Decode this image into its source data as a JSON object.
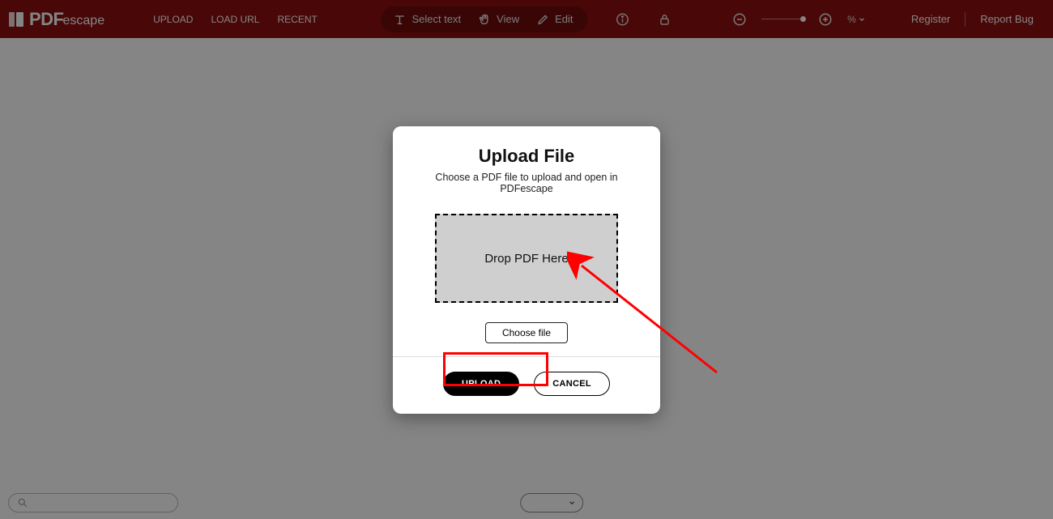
{
  "brand": {
    "prefix": "PDF",
    "suffix": "escape"
  },
  "nav": {
    "upload": "UPLOAD",
    "loadurl": "LOAD URL",
    "recent": "RECENT"
  },
  "toolbar": {
    "select_text": "Select text",
    "view": "View",
    "edit": "Edit",
    "zoom_value": "%"
  },
  "header_right": {
    "register": "Register",
    "report_bug": "Report Bug"
  },
  "modal": {
    "title": "Upload File",
    "subtitle": "Choose a PDF file to upload and open in PDFescape",
    "dropzone_text": "Drop PDF Here",
    "choose_file": "Choose file",
    "upload_btn": "UPLOAD",
    "cancel_btn": "CANCEL"
  },
  "icons": {
    "logo": "pdf-logo-icon",
    "text_select": "text-select-icon",
    "hand": "hand-icon",
    "pencil": "pencil-icon",
    "info": "info-icon",
    "lock": "lock-icon",
    "zoom_out": "zoom-out-icon",
    "zoom_in": "zoom-in-icon",
    "chevron_down": "chevron-down-icon",
    "search": "search-icon"
  },
  "colors": {
    "brand_bar": "#8d0f0f",
    "accent_red": "#ff0000"
  }
}
